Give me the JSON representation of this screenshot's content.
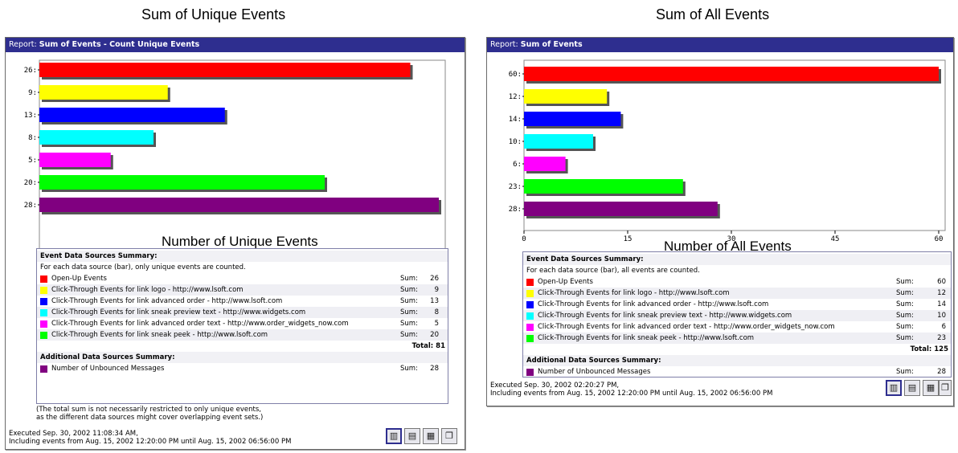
{
  "captions": [
    "Sum of Unique Events",
    "Sum of All Events"
  ],
  "chart_data": [
    {
      "type": "bar",
      "orientation": "horizontal",
      "report_prefix": "Report:",
      "report_name": "Sum of Events - Count Unique Events",
      "categories": [
        "26:",
        "9:",
        "13:",
        "8:",
        "5:",
        "20:",
        "28:"
      ],
      "values": [
        26,
        9,
        13,
        8,
        5,
        20,
        28
      ],
      "colors": [
        "#ff0000",
        "#ffff00",
        "#0000ff",
        "#00ffff",
        "#ff00ff",
        "#00ff00",
        "#800080"
      ],
      "xlim": [
        0,
        28
      ],
      "xticks": [
        "0",
        "7",
        "14",
        "21",
        "28"
      ],
      "xlabel": "Number of Unique Events",
      "grid": false,
      "legend": "none"
    },
    {
      "type": "bar",
      "orientation": "horizontal",
      "report_prefix": "Report:",
      "report_name": "Sum of Events",
      "categories": [
        "60:",
        "12:",
        "14:",
        "10:",
        "6:",
        "23:",
        "28:"
      ],
      "values": [
        60,
        12,
        14,
        10,
        6,
        23,
        28
      ],
      "colors": [
        "#ff0000",
        "#ffff00",
        "#0000ff",
        "#00ffff",
        "#ff00ff",
        "#00ff00",
        "#800080"
      ],
      "xlim": [
        0,
        60
      ],
      "xticks": [
        "0",
        "15",
        "30",
        "45",
        "60"
      ],
      "xlabel": "Number of All Events",
      "grid": false,
      "legend": "none"
    }
  ],
  "summaries": [
    {
      "header": "Event Data Sources Summary:",
      "note": "For each data source (bar), only unique events are counted.",
      "rows": [
        {
          "color": "#ff0000",
          "label": "Open-Up Events",
          "sum_label": "Sum:",
          "value": "26"
        },
        {
          "color": "#ffff00",
          "label": "Click-Through Events for link logo - http://www.lsoft.com",
          "sum_label": "Sum:",
          "value": "9"
        },
        {
          "color": "#0000ff",
          "label": "Click-Through Events for link advanced order - http://www.lsoft.com",
          "sum_label": "Sum:",
          "value": "13"
        },
        {
          "color": "#00ffff",
          "label": "Click-Through Events for link sneak preview text - http://www.widgets.com",
          "sum_label": "Sum:",
          "value": "8"
        },
        {
          "color": "#ff00ff",
          "label": "Click-Through Events for link advanced order text - http://www.order_widgets_now.com",
          "sum_label": "Sum:",
          "value": "5"
        },
        {
          "color": "#00ff00",
          "label": "Click-Through Events for link sneak peek - http://www.lsoft.com",
          "sum_label": "Sum:",
          "value": "20"
        }
      ],
      "total": "Total: 81",
      "additional_header": "Additional Data Sources Summary:",
      "additional_rows": [
        {
          "color": "#800080",
          "label": "Number of Unbounced Messages",
          "sum_label": "Sum:",
          "value": "28"
        }
      ],
      "footnote_1": "(The total sum is not necessarily restricted to only unique events,",
      "footnote_2": "as the different data sources might cover overlapping event sets.)",
      "executed": "Executed Sep. 30, 2002 11:08:34 AM,",
      "range": "Including events from Aug. 15, 2002 12:20:00 PM until Aug. 15, 2002 06:56:00 PM"
    },
    {
      "header": "Event Data Sources Summary:",
      "note": "For each data source (bar), all events are counted.",
      "rows": [
        {
          "color": "#ff0000",
          "label": "Open-Up Events",
          "sum_label": "Sum:",
          "value": "60"
        },
        {
          "color": "#ffff00",
          "label": "Click-Through Events for link logo - http://www.lsoft.com",
          "sum_label": "Sum:",
          "value": "12"
        },
        {
          "color": "#0000ff",
          "label": "Click-Through Events for link advanced order - http://www.lsoft.com",
          "sum_label": "Sum:",
          "value": "14"
        },
        {
          "color": "#00ffff",
          "label": "Click-Through Events for link sneak preview text - http://www.widgets.com",
          "sum_label": "Sum:",
          "value": "10"
        },
        {
          "color": "#ff00ff",
          "label": "Click-Through Events for link advanced order text - http://www.order_widgets_now.com",
          "sum_label": "Sum:",
          "value": "6"
        },
        {
          "color": "#00ff00",
          "label": "Click-Through Events for link sneak peek - http://www.lsoft.com",
          "sum_label": "Sum:",
          "value": "23"
        }
      ],
      "total": "Total: 125",
      "additional_header": "Additional Data Sources Summary:",
      "additional_rows": [
        {
          "color": "#800080",
          "label": "Number of Unbounced Messages",
          "sum_label": "Sum:",
          "value": "28"
        }
      ],
      "executed": "Executed Sep. 30, 2002 02:20:27 PM,",
      "range": "Including events from Aug. 15, 2002 12:20:00 PM until Aug. 15, 2002 06:56:00 PM"
    }
  ],
  "toolbar_icons": [
    "bar-chart-icon",
    "stacked-chart-icon",
    "horizontal-chart-icon",
    "copy-icon"
  ]
}
